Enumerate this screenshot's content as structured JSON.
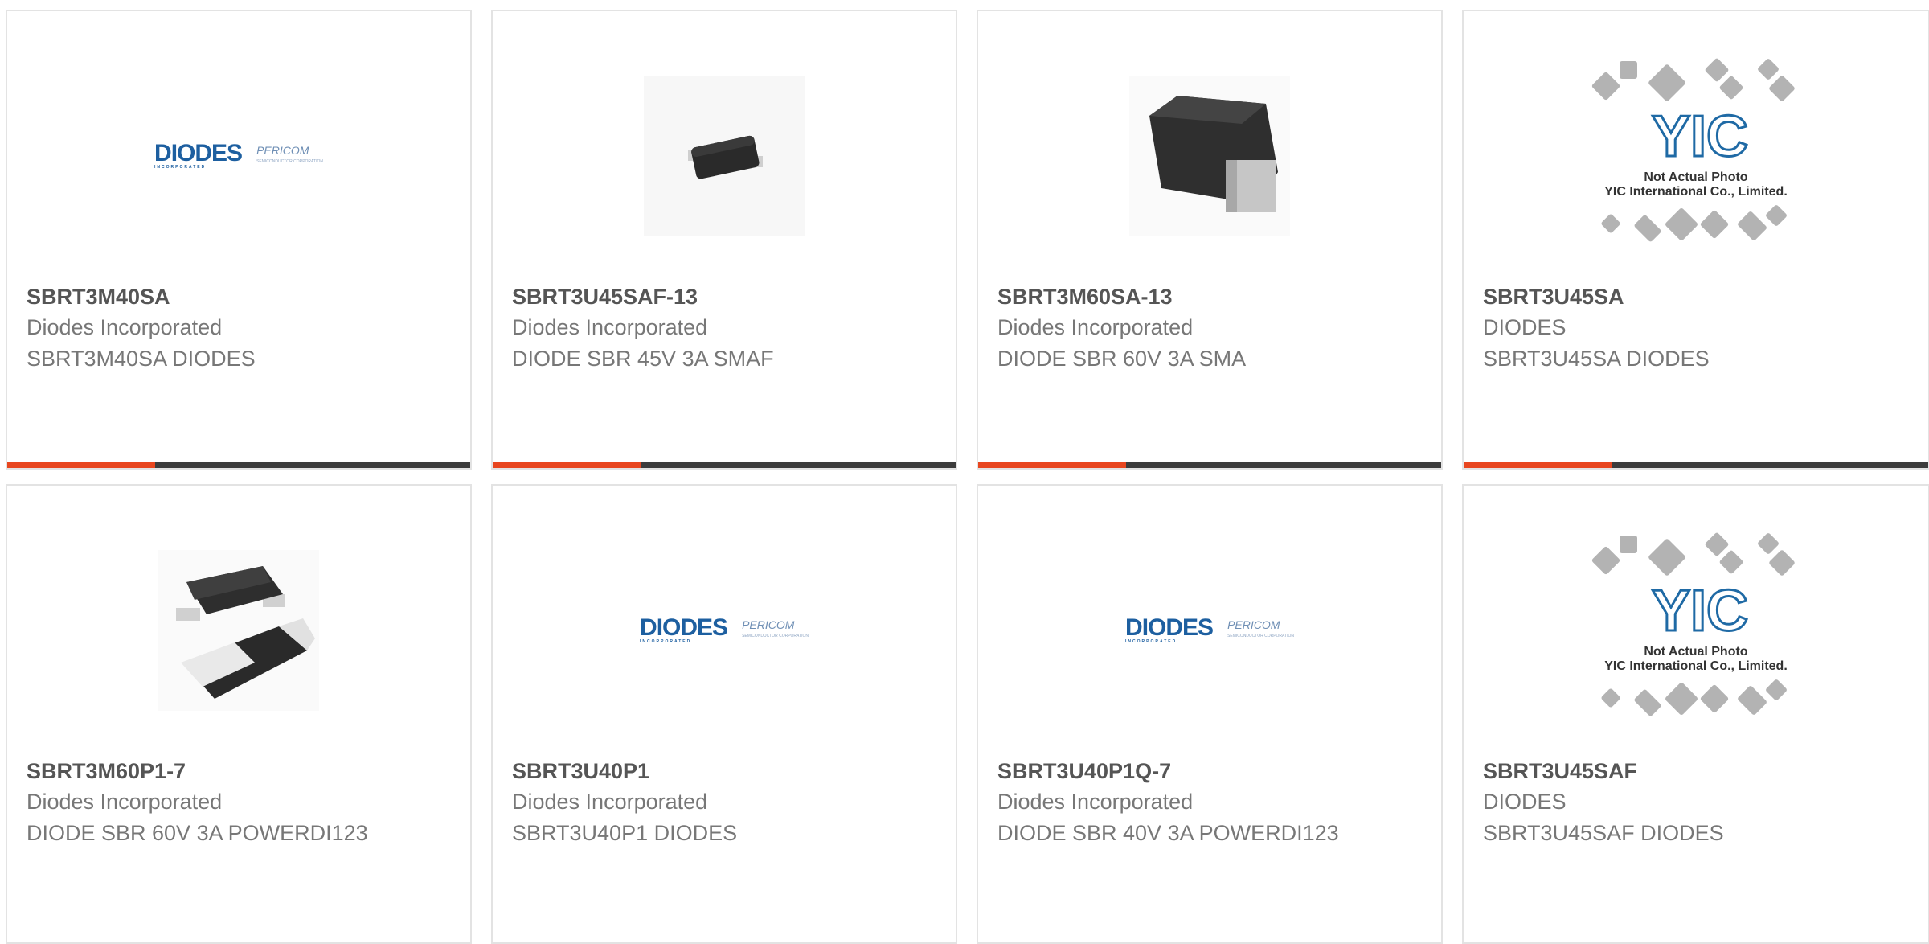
{
  "cards": [
    {
      "part": "SBRT3M40SA",
      "manufacturer": "Diodes Incorporated",
      "description": "SBRT3M40SA DIODES",
      "image": "diodes-logo"
    },
    {
      "part": "SBRT3U45SAF-13",
      "manufacturer": "Diodes Incorporated",
      "description": "DIODE SBR 45V 3A SMAF",
      "image": "smaf-package-photo"
    },
    {
      "part": "SBRT3M60SA-13",
      "manufacturer": "Diodes Incorporated",
      "description": "DIODE SBR 60V 3A SMA",
      "image": "sma-package-photo"
    },
    {
      "part": "SBRT3U45SA",
      "manufacturer": "DIODES",
      "description": "SBRT3U45SA DIODES",
      "image": "not-actual-photo"
    },
    {
      "part": "SBRT3M60P1-7",
      "manufacturer": "Diodes Incorporated",
      "description": "DIODE SBR 60V 3A POWERDI123",
      "image": "powerdi123-package-photo"
    },
    {
      "part": "SBRT3U40P1",
      "manufacturer": "Diodes Incorporated",
      "description": "SBRT3U40P1 DIODES",
      "image": "diodes-logo"
    },
    {
      "part": "SBRT3U40P1Q-7",
      "manufacturer": "Diodes Incorporated",
      "description": "DIODE SBR 40V 3A POWERDI123",
      "image": "diodes-logo"
    },
    {
      "part": "SBRT3U45SAF",
      "manufacturer": "DIODES",
      "description": "SBRT3U45SAF DIODES",
      "image": "not-actual-photo"
    }
  ],
  "logo": {
    "brand": "DIODES",
    "tagline": "INCORPORATED",
    "partner": "PERICOM",
    "partner_tagline": "SEMICONDUCTOR CORPORATION"
  },
  "placeholder": {
    "mark": "YIC",
    "line1": "Not Actual Photo",
    "line2": "YIC International Co., Limited."
  },
  "colors": {
    "accent": "#e8461f",
    "bar": "#3c3c3c",
    "border": "#e3e3e3",
    "logo_blue": "#1d5fa0"
  }
}
